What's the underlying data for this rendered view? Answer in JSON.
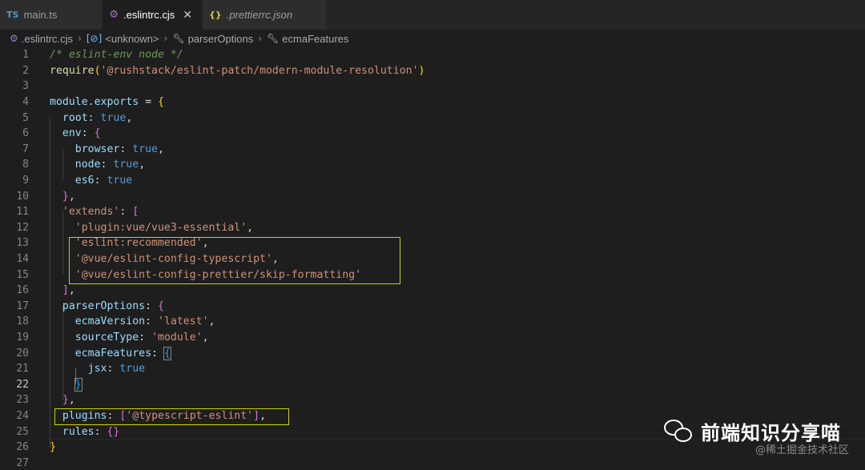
{
  "tabs": [
    {
      "icon": "TS",
      "label": "main.ts",
      "italic": false
    },
    {
      "icon": "⚙",
      "label": ".eslintrc.cjs",
      "italic": false,
      "close": "✕"
    },
    {
      "icon": "{}",
      "label": ".prettierrc.json",
      "italic": true
    }
  ],
  "breadcrumb": [
    ".eslintrc.cjs",
    "<unknown>",
    "parserOptions",
    "ecmaFeatures"
  ],
  "code_lines": [
    "/* eslint-env node */",
    "require('@rushstack/eslint-patch/modern-module-resolution')",
    "",
    "module.exports = {",
    "  root: true,",
    "  env: {",
    "    browser: true,",
    "    node: true,",
    "    es6: true",
    "  },",
    "  'extends': [",
    "    'plugin:vue/vue3-essential',",
    "    'eslint:recommended',",
    "    '@vue/eslint-config-typescript',",
    "    '@vue/eslint-config-prettier/skip-formatting'",
    "  ],",
    "  parserOptions: {",
    "    ecmaVersion: 'latest',",
    "    sourceType: 'module',",
    "    ecmaFeatures: {",
    "      jsx: true",
    "    }",
    "  },",
    "  plugins: ['@typescript-eslint'],",
    "  rules: {}",
    "}",
    ""
  ],
  "line_numbers": [
    "1",
    "2",
    "3",
    "4",
    "5",
    "6",
    "7",
    "8",
    "9",
    "10",
    "11",
    "12",
    "13",
    "14",
    "15",
    "16",
    "17",
    "18",
    "19",
    "20",
    "21",
    "22",
    "23",
    "24",
    "25",
    "26",
    "27"
  ],
  "current_line": 22,
  "watermark": {
    "title": "前端知识分享喵",
    "subtitle": "@稀土掘金技术社区"
  },
  "colors": {
    "background": "#1e1e1e",
    "highlight_box": "#c8d400",
    "comment": "#6a9955",
    "string": "#ce9178",
    "property": "#9cdcfe",
    "keyword": "#569cd6"
  }
}
